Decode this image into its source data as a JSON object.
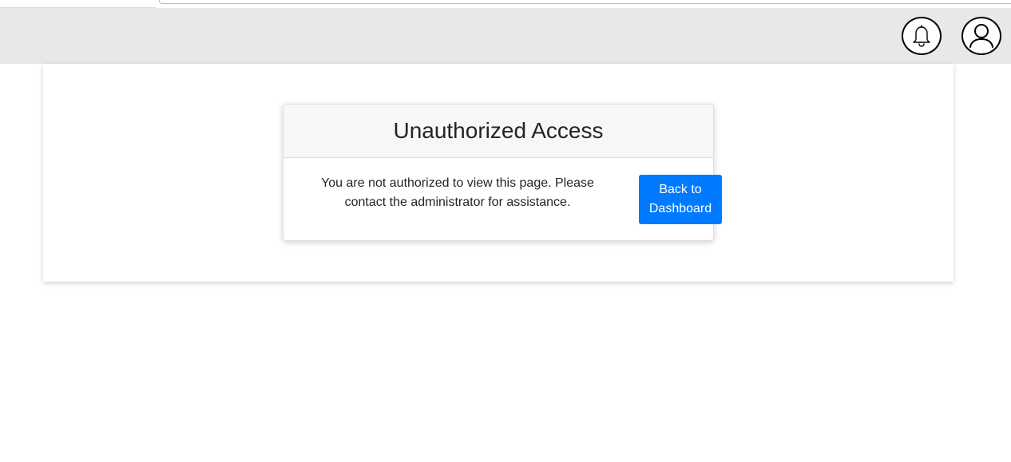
{
  "header": {
    "notifications_icon": "bell-icon",
    "profile_icon": "user-icon"
  },
  "card": {
    "title": "Unauthorized Access",
    "message": "You are not authorized to view this page. Please contact the administrator for assistance.",
    "button_label": "Back to Dashboard",
    "button_color": "#007bff"
  },
  "colors": {
    "header_background": "#e8e8e8",
    "card_header_background": "#f7f7f7",
    "page_background": "#ffffff"
  }
}
